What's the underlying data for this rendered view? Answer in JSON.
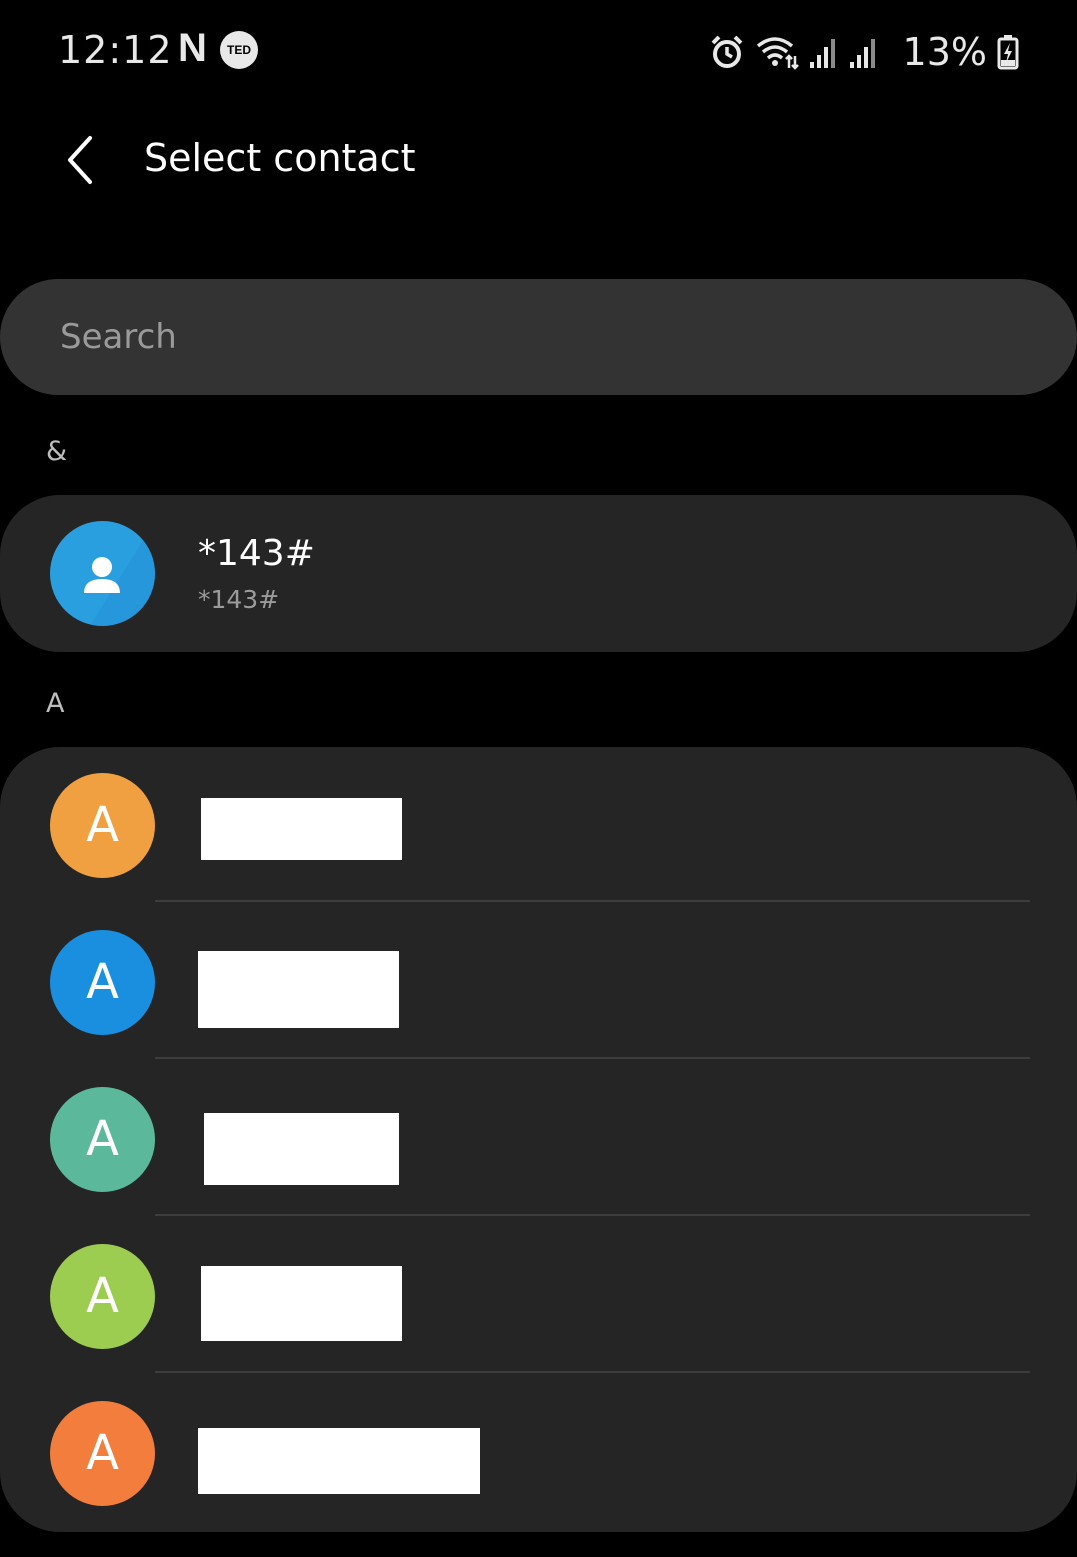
{
  "status_bar": {
    "time": "12:12",
    "netflix_badge": "N",
    "ted_badge": "TED",
    "battery_percent": "13%",
    "icons": [
      "alarm-icon",
      "wifi-icon",
      "signal-icon",
      "signal-icon",
      "battery-charging-icon"
    ]
  },
  "header": {
    "title": "Select contact",
    "back_icon": "chevron-left-icon"
  },
  "search": {
    "placeholder": "Search",
    "value": ""
  },
  "sections": [
    {
      "header": "&",
      "contacts": [
        {
          "name": "*143#",
          "number": "*143#",
          "avatar": "person-icon",
          "avatar_color": "#2a9fe0"
        }
      ]
    },
    {
      "header": "A",
      "contacts": [
        {
          "avatar_letter": "A",
          "avatar_color": "#f0a040"
        },
        {
          "avatar_letter": "A",
          "avatar_color": "#1a8fe0"
        },
        {
          "avatar_letter": "A",
          "avatar_color": "#5cb89a"
        },
        {
          "avatar_letter": "A",
          "avatar_color": "#9ccc50"
        },
        {
          "avatar_letter": "A",
          "avatar_color": "#f27d3c"
        }
      ]
    }
  ],
  "colors": {
    "background": "#000000",
    "card": "#252525",
    "search_field": "#333333"
  }
}
